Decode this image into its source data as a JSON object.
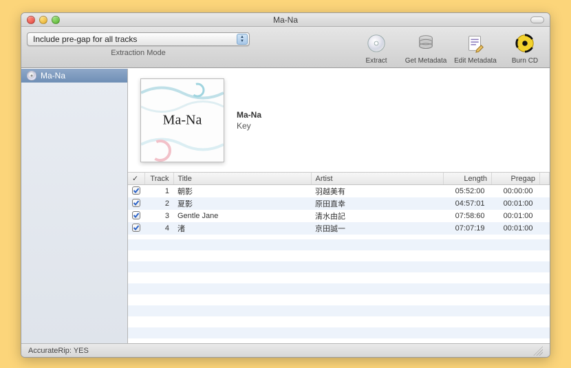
{
  "window": {
    "title": "Ma-Na"
  },
  "toolbar": {
    "mode_value": "Include pre-gap for all tracks",
    "mode_label": "Extraction Mode",
    "items": {
      "extract": "Extract",
      "get_metadata": "Get Metadata",
      "edit_metadata": "Edit Metadata",
      "burn_cd": "Burn CD"
    }
  },
  "sidebar": {
    "selected": "Ma-Na"
  },
  "album": {
    "title": "Ma-Na",
    "artist": "Key",
    "cover_text": "Ma-Na"
  },
  "columns": {
    "check": "✓",
    "track": "Track",
    "title": "Title",
    "artist": "Artist",
    "length": "Length",
    "pregap": "Pregap"
  },
  "tracks": [
    {
      "checked": true,
      "n": 1,
      "title": "朝影",
      "artist": "羽越美有",
      "length": "05:52:00",
      "pregap": "00:00:00"
    },
    {
      "checked": true,
      "n": 2,
      "title": "夏影",
      "artist": "原田直幸",
      "length": "04:57:01",
      "pregap": "00:01:00"
    },
    {
      "checked": true,
      "n": 3,
      "title": "Gentle Jane",
      "artist": "清水由記",
      "length": "07:58:60",
      "pregap": "00:01:00"
    },
    {
      "checked": true,
      "n": 4,
      "title": "渚",
      "artist": "京田誠一",
      "length": "07:07:19",
      "pregap": "00:01:00"
    }
  ],
  "status": {
    "accuraterip": "AccurateRip: YES"
  }
}
